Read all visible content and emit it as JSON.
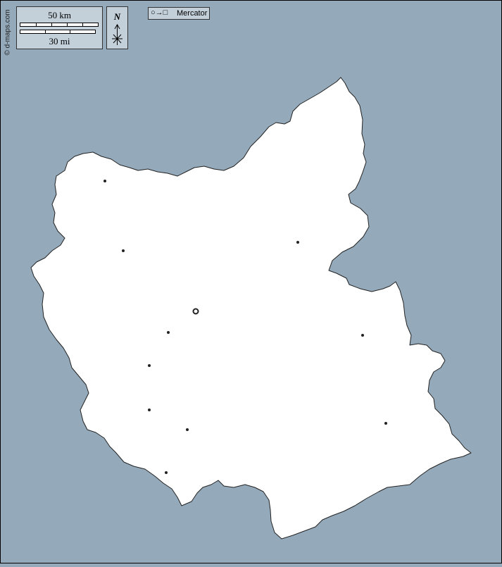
{
  "credit": "© d-maps.com",
  "scale": {
    "km_label": "50 km",
    "mi_label": "30 mi"
  },
  "north": {
    "label": "N"
  },
  "projection": {
    "glyph": "○→□",
    "name": "Mercator"
  },
  "colors": {
    "sea": "#94aabb",
    "land": "#ffffff",
    "panel": "#c3d0da",
    "outline": "#222222"
  },
  "icons": {
    "north_arrow": "north-arrow-icon",
    "capital": "capital-circle-icon",
    "town": "town-dot-icon"
  },
  "places": {
    "capital_count": 1,
    "town_count": 10
  }
}
